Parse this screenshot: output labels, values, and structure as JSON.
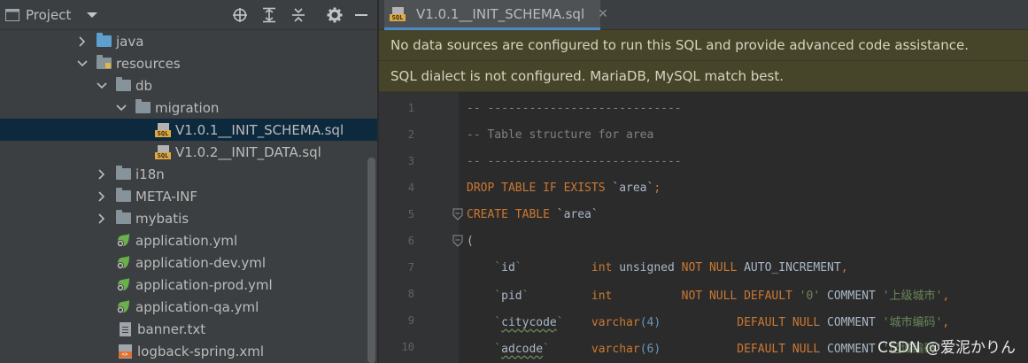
{
  "project_pane": {
    "title": "Project",
    "title_icon": "project-view-icon",
    "dropdown_icon": "chevron-down-icon",
    "toolbar_icons": [
      "locate-icon",
      "expand-all-icon",
      "collapse-all-icon",
      "gear-icon",
      "minimize-icon"
    ]
  },
  "tree": [
    {
      "label": "java",
      "icon": "folder-source-icon",
      "arrow": "collapsed"
    },
    {
      "label": "resources",
      "icon": "folder-resources-icon",
      "arrow": "expanded"
    },
    {
      "label": "db",
      "icon": "folder-icon",
      "arrow": "expanded"
    },
    {
      "label": "migration",
      "icon": "folder-icon",
      "arrow": "expanded"
    },
    {
      "label": "V1.0.1__INIT_SCHEMA.sql",
      "icon": "sql-file-icon",
      "selected": true
    },
    {
      "label": "V1.0.2__INIT_DATA.sql",
      "icon": "sql-file-icon"
    },
    {
      "label": "i18n",
      "icon": "folder-icon",
      "arrow": "collapsed"
    },
    {
      "label": "META-INF",
      "icon": "folder-icon",
      "arrow": "collapsed"
    },
    {
      "label": "mybatis",
      "icon": "folder-icon",
      "arrow": "collapsed"
    },
    {
      "label": "application.yml",
      "icon": "spring-config-icon"
    },
    {
      "label": "application-dev.yml",
      "icon": "spring-config-icon"
    },
    {
      "label": "application-prod.yml",
      "icon": "spring-config-icon"
    },
    {
      "label": "application-qa.yml",
      "icon": "spring-config-icon"
    },
    {
      "label": "banner.txt",
      "icon": "text-file-icon"
    },
    {
      "label": "logback-spring.xml",
      "icon": "xml-file-icon"
    }
  ],
  "editor": {
    "tab": {
      "label": "V1.0.1__INIT_SCHEMA.sql",
      "icon": "sql-file-icon",
      "close_icon": "close-icon"
    },
    "banners": [
      "No data sources are configured to run this SQL and provide advanced code assistance.",
      "SQL dialect is not configured. MariaDB, MySQL match best."
    ],
    "lines": [
      {
        "num": "1",
        "tokens": [
          {
            "t": "-- ----------------------------",
            "c": "comment"
          }
        ]
      },
      {
        "num": "2",
        "tokens": [
          {
            "t": "-- Table structure for area",
            "c": "comment"
          }
        ]
      },
      {
        "num": "3",
        "tokens": [
          {
            "t": "-- ----------------------------",
            "c": "comment"
          }
        ]
      },
      {
        "num": "4",
        "tokens": [
          {
            "t": "DROP TABLE IF EXISTS ",
            "c": "keyword"
          },
          {
            "t": "`area`",
            "c": "ident"
          },
          {
            "t": ";",
            "c": "keyword"
          }
        ]
      },
      {
        "num": "5",
        "fold": true,
        "tokens": [
          {
            "t": "CREATE TABLE ",
            "c": "keyword"
          },
          {
            "t": "`area`",
            "c": "ident"
          }
        ]
      },
      {
        "num": "6",
        "fold": true,
        "tokens": [
          {
            "t": "(",
            "c": "default"
          }
        ]
      },
      {
        "num": "7",
        "tokens": [
          {
            "t": "    `",
            "c": "string"
          },
          {
            "t": "id",
            "c": "ident"
          },
          {
            "t": "`",
            "c": "string"
          },
          {
            "t": "          int ",
            "c": "type"
          },
          {
            "t": "unsigned ",
            "c": "ident"
          },
          {
            "t": "NOT NULL ",
            "c": "keyword"
          },
          {
            "t": "AUTO_INCREMENT",
            "c": "ident"
          },
          {
            "t": ",",
            "c": "keyword"
          }
        ]
      },
      {
        "num": "8",
        "tokens": [
          {
            "t": "    `",
            "c": "string"
          },
          {
            "t": "pid",
            "c": "ident"
          },
          {
            "t": "`",
            "c": "string"
          },
          {
            "t": "         int          ",
            "c": "type"
          },
          {
            "t": "NOT NULL ",
            "c": "keyword"
          },
          {
            "t": "DEFAULT ",
            "c": "keyword"
          },
          {
            "t": "'0' ",
            "c": "string"
          },
          {
            "t": "COMMENT ",
            "c": "ident"
          },
          {
            "t": "'上级城市'",
            "c": "string"
          },
          {
            "t": ",",
            "c": "keyword"
          }
        ]
      },
      {
        "num": "9",
        "tokens": [
          {
            "t": "    `",
            "c": "string"
          },
          {
            "t": "citycode",
            "c": "ident",
            "u": true
          },
          {
            "t": "`",
            "c": "string"
          },
          {
            "t": "    varchar",
            "c": "type"
          },
          {
            "t": "(4)",
            "c": "number"
          },
          {
            "t": "           DEFAULT NULL ",
            "c": "keyword"
          },
          {
            "t": "COMMENT ",
            "c": "ident"
          },
          {
            "t": "'城市编码'",
            "c": "string"
          },
          {
            "t": ",",
            "c": "keyword"
          }
        ]
      },
      {
        "num": "10",
        "tokens": [
          {
            "t": "    `",
            "c": "string"
          },
          {
            "t": "adcode",
            "c": "ident",
            "u": true
          },
          {
            "t": "`",
            "c": "string"
          },
          {
            "t": "      varchar",
            "c": "type"
          },
          {
            "t": "(6)",
            "c": "number"
          },
          {
            "t": "           DEFAULT NULL ",
            "c": "keyword"
          },
          {
            "t": "COMMENT ",
            "c": "ident"
          },
          {
            "t": "'区域编码'",
            "c": "string"
          },
          {
            "t": ",",
            "c": "keyword"
          }
        ]
      }
    ]
  },
  "watermark": "CSDN @爱泥かりん"
}
